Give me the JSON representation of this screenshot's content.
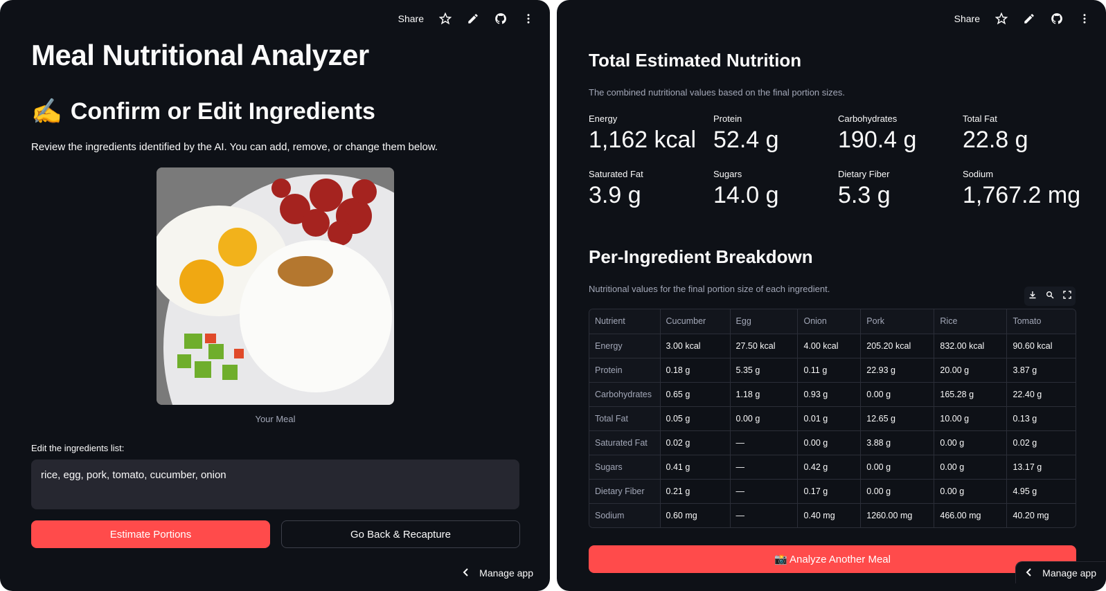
{
  "toolbar": {
    "share_label": "Share",
    "icons": [
      "star-icon",
      "pencil-icon",
      "github-icon",
      "more-vertical-icon"
    ]
  },
  "left": {
    "title": "Meal Nutritional Analyzer",
    "section_emoji": "✍️",
    "section_title": "Confirm or Edit Ingredients",
    "description": "Review the ingredients identified by the AI. You can add, remove, or change them below.",
    "image_caption": "Your Meal",
    "ingredients_label": "Edit the ingredients list:",
    "ingredients_value": "rice, egg, pork, tomato, cucumber, onion",
    "estimate_button": "Estimate Portions",
    "goback_button": "Go Back & Recapture",
    "manage_app": "Manage app"
  },
  "right": {
    "total_title": "Total Estimated Nutrition",
    "total_subtitle": "The combined nutritional values based on the final portion sizes.",
    "metrics": [
      {
        "label": "Energy",
        "value": "1,162 kcal"
      },
      {
        "label": "Protein",
        "value": "52.4 g"
      },
      {
        "label": "Carbohydrates",
        "value": "190.4 g"
      },
      {
        "label": "Total Fat",
        "value": "22.8 g"
      },
      {
        "label": "Saturated Fat",
        "value": "3.9 g"
      },
      {
        "label": "Sugars",
        "value": "14.0 g"
      },
      {
        "label": "Dietary Fiber",
        "value": "5.3 g"
      },
      {
        "label": "Sodium",
        "value": "1,767.2 mg"
      }
    ],
    "breakdown_title": "Per-Ingredient Breakdown",
    "breakdown_subtitle": "Nutritional values for the final portion size of each ingredient.",
    "table": {
      "headers": [
        "Nutrient",
        "Cucumber",
        "Egg",
        "Onion",
        "Pork",
        "Rice",
        "Tomato"
      ],
      "rows": [
        [
          "Energy",
          "3.00 kcal",
          "27.50 kcal",
          "4.00 kcal",
          "205.20 kcal",
          "832.00 kcal",
          "90.60 kcal"
        ],
        [
          "Protein",
          "0.18 g",
          "5.35 g",
          "0.11 g",
          "22.93 g",
          "20.00 g",
          "3.87 g"
        ],
        [
          "Carbohydrates",
          "0.65 g",
          "1.18 g",
          "0.93 g",
          "0.00 g",
          "165.28 g",
          "22.40 g"
        ],
        [
          "Total Fat",
          "0.05 g",
          "0.00 g",
          "0.01 g",
          "12.65 g",
          "10.00 g",
          "0.13 g"
        ],
        [
          "Saturated Fat",
          "0.02 g",
          "—",
          "0.00 g",
          "3.88 g",
          "0.00 g",
          "0.02 g"
        ],
        [
          "Sugars",
          "0.41 g",
          "—",
          "0.42 g",
          "0.00 g",
          "0.00 g",
          "13.17 g"
        ],
        [
          "Dietary Fiber",
          "0.21 g",
          "—",
          "0.17 g",
          "0.00 g",
          "0.00 g",
          "4.95 g"
        ],
        [
          "Sodium",
          "0.60 mg",
          "—",
          "0.40 mg",
          "1260.00 mg",
          "466.00 mg",
          "40.20 mg"
        ]
      ]
    },
    "analyze_button": "📸 Analyze Another Meal",
    "manage_app": "Manage app"
  },
  "colors": {
    "background": "#0e1117",
    "primary": "#ff4b4b",
    "input_bg": "#262730",
    "muted_text": "#a3a8b8"
  }
}
